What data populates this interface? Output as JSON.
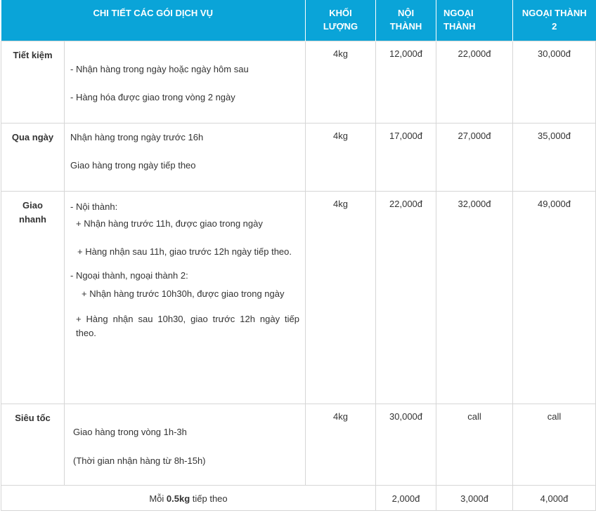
{
  "header": {
    "col_details": "CHI TIẾT CÁC GÓI DỊCH VỤ",
    "col_weight_l1": "KHỐI",
    "col_weight_l2": "LƯỢNG",
    "col_inner_l1": "NỘI",
    "col_inner_l2": "THÀNH",
    "col_outer_l1": "NGOẠI",
    "col_outer_l2": "THÀNH",
    "col_outer2_l1": "NGOẠI THÀNH",
    "col_outer2_l2": "2"
  },
  "rows": [
    {
      "name": "Tiết kiệm",
      "desc": [
        "- Nhận hàng trong ngày hoặc ngày hôm sau",
        "- Hàng hóa được giao trong vòng 2 ngày"
      ],
      "weight": "4kg",
      "inner": "12,000đ",
      "outer": "22,000đ",
      "outer2": "30,000đ"
    },
    {
      "name": "Qua ngày",
      "desc": [
        "Nhận hàng trong ngày trước 16h",
        "Giao hàng trong ngày tiếp theo"
      ],
      "weight": "4kg",
      "inner": "17,000đ",
      "outer": "27,000đ",
      "outer2": "35,000đ"
    },
    {
      "name_l1": "Giao",
      "name_l2": "nhanh",
      "desc": [
        "- Nội thành:",
        "+ Nhận hàng trước 11h, được giao trong ngày",
        "+ Hàng nhận sau 11h, giao trước 12h ngày tiếp theo.",
        "- Ngoại thành, ngoại thành 2:",
        "+ Nhận hàng trước 10h30h, được giao trong ngày",
        "+ Hàng nhận sau 10h30, giao trước 12h ngày tiếp theo."
      ],
      "weight": "4kg",
      "inner": "22,000đ",
      "outer": "32,000đ",
      "outer2": "49,000đ"
    },
    {
      "name": "Siêu tốc",
      "desc": [
        "Giao hàng trong vòng 1h-3h",
        "(Thời gian nhận hàng từ 8h-15h)"
      ],
      "weight": "4kg",
      "inner": "30,000đ",
      "outer": "call",
      "outer2": "call"
    }
  ],
  "footer": {
    "prefix": "Mỗi ",
    "weight": "0.5kg",
    "suffix": " tiếp theo",
    "inner": "2,000đ",
    "outer": "3,000đ",
    "outer2": "4,000đ"
  }
}
